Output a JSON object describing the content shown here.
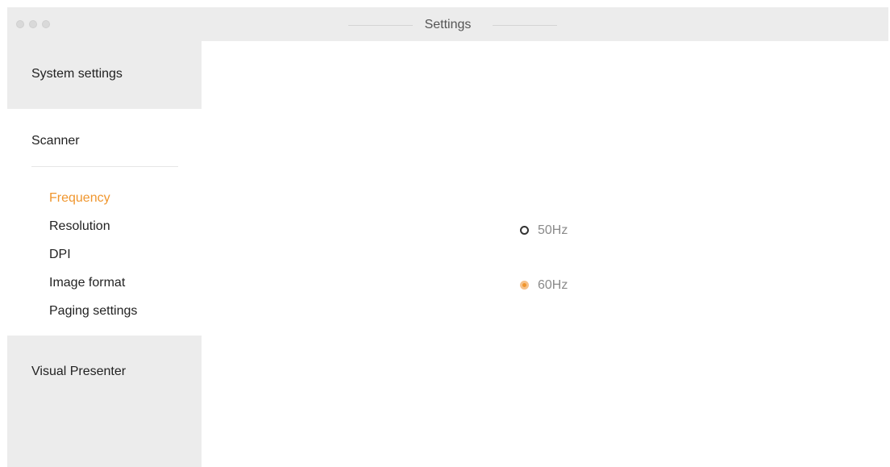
{
  "window": {
    "title": "Settings"
  },
  "sidebar": {
    "system_label": "System settings",
    "scanner_label": "Scanner",
    "scanner_items": [
      {
        "label": "Frequency",
        "active": true
      },
      {
        "label": "Resolution",
        "active": false
      },
      {
        "label": "DPI",
        "active": false
      },
      {
        "label": "Image format",
        "active": false
      },
      {
        "label": "Paging settings",
        "active": false
      }
    ],
    "visual_label": "Visual Presenter"
  },
  "frequency": {
    "options": [
      {
        "label": "50Hz",
        "selected": false
      },
      {
        "label": "60Hz",
        "selected": true
      }
    ]
  },
  "colors": {
    "accent": "#f0962e",
    "sidebar_bg": "#ececec",
    "titlebar_bg": "#ececec"
  }
}
